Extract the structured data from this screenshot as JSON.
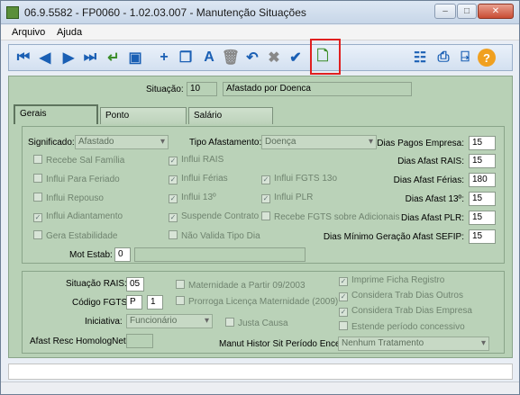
{
  "window": {
    "title": "06.9.5582 - FP0060 - 1.02.03.007 - Manutenção Situações"
  },
  "menu": [
    "Arquivo",
    "Ajuda"
  ],
  "header": {
    "situacao_label": "Situação:",
    "code": "10",
    "description": "Afastado por Doenca"
  },
  "tabs": [
    "Gerais",
    "Ponto",
    "Salário"
  ],
  "gerais": {
    "significado_label": "Significado:",
    "significado": "Afastado",
    "tipo_label": "Tipo Afastamento:",
    "tipo": "Doença",
    "checks": [
      {
        "label": "Recebe Sal Família",
        "checked": false
      },
      {
        "label": "Influi Para Feriado",
        "checked": false
      },
      {
        "label": "Influi Repouso",
        "checked": false
      },
      {
        "label": "Influi Adiantamento",
        "checked": true
      },
      {
        "label": "Gera Estabilidade",
        "checked": false
      },
      {
        "label": "Influi RAIS",
        "checked": true
      },
      {
        "label": "Influi Férias",
        "checked": true
      },
      {
        "label": "Influi 13º",
        "checked": true
      },
      {
        "label": "Suspende Contrato",
        "checked": true
      },
      {
        "label": "Não Valida Tipo Dia",
        "checked": false
      },
      {
        "label": "Influi FGTS 13o",
        "checked": true
      },
      {
        "label": "Influi PLR",
        "checked": true
      },
      {
        "label": "Recebe FGTS sobre Adicionais",
        "checked": false
      }
    ],
    "dias": [
      {
        "label": "Dias Pagos Empresa:",
        "value": "15"
      },
      {
        "label": "Dias Afast RAIS:",
        "value": "15"
      },
      {
        "label": "Dias Afast Férias:",
        "value": "180"
      },
      {
        "label": "Dias Afast 13º:",
        "value": "15"
      },
      {
        "label": "Dias Afast PLR:",
        "value": "15"
      },
      {
        "label": "Dias Mínimo Geração Afast SEFIP:",
        "value": "15"
      }
    ],
    "mot_estab_label": "Mot Estab:",
    "mot_estab": "0"
  },
  "bottom": {
    "sit_rais_label": "Situação RAIS:",
    "sit_rais": "05",
    "fgts_label": "Código FGTS:",
    "fgts_a": "P",
    "fgts_b": "1",
    "iniciativa_label": "Iniciativa:",
    "iniciativa": "Funcionário",
    "afast_label": "Afast Resc HomologNet:",
    "checks_mid": [
      {
        "label": "Maternidade a Partir 09/2003",
        "checked": false
      },
      {
        "label": "Prorroga Licença Maternidade (2009)",
        "checked": false
      },
      {
        "label": "Justa Causa",
        "checked": false
      }
    ],
    "checks_right": [
      {
        "label": "Imprime Ficha Registro",
        "checked": true
      },
      {
        "label": "Considera Trab Dias Outros",
        "checked": true
      },
      {
        "label": "Considera Trab Dias Empresa",
        "checked": true
      },
      {
        "label": "Estende período concessivo",
        "checked": false
      }
    ],
    "manut_label": "Manut Histor Sit Período Encer:",
    "manut": "Nenhum Tratamento"
  }
}
